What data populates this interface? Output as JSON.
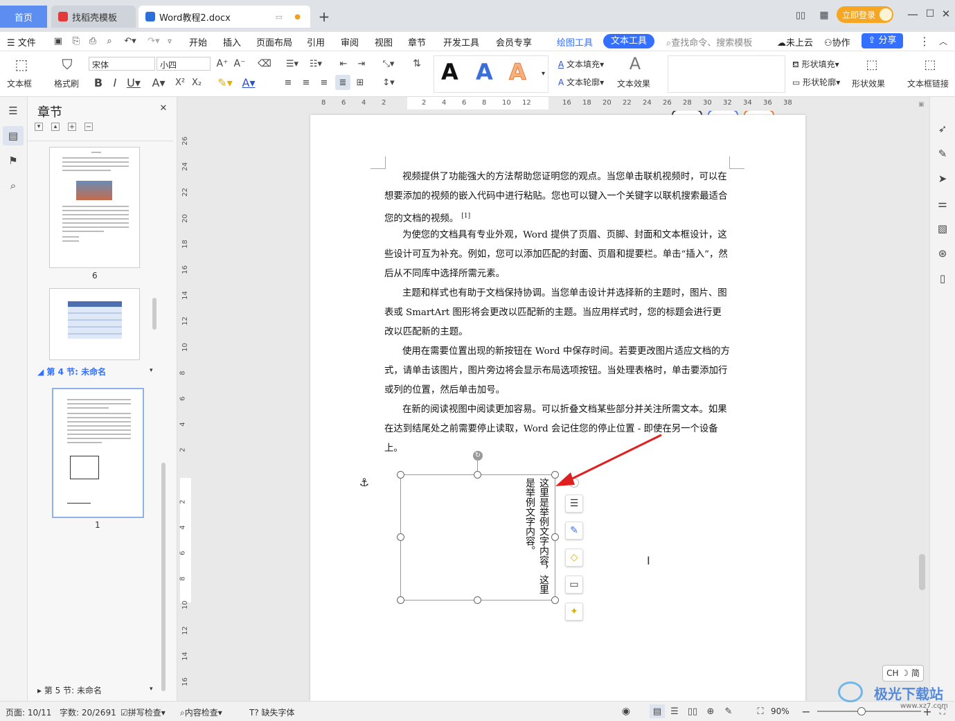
{
  "tabs": {
    "home": "首页",
    "templates": "找稻壳模板",
    "doc": "Word教程2.docx"
  },
  "window": {
    "login": "立即登录"
  },
  "menu": {
    "file": "文件",
    "items": [
      "开始",
      "插入",
      "页面布局",
      "引用",
      "审阅",
      "视图",
      "章节",
      "开发工具",
      "会员专享"
    ],
    "draw_tools": "绘图工具",
    "text_tools": "文本工具",
    "search": "查找命令、搜索模板",
    "cloud": "未上云",
    "collab": "协作",
    "share": "分享"
  },
  "toolbar": {
    "textbox": "文本框",
    "format_painter": "格式刷",
    "font": "宋体",
    "size": "小四",
    "text_fill": "文本填充",
    "text_outline": "文本轮廓",
    "text_effect": "文本效果",
    "style_a": "A",
    "abc": "Abc",
    "shape_fill": "形状填充",
    "shape_outline": "形状轮廓",
    "shape_effect": "形状效果",
    "textbox_link": "文本框链接"
  },
  "nav": {
    "title": "章节",
    "thumb6_num": "6",
    "section4": "第 4 节: 未命名",
    "thumb1_num": "1",
    "section5": "第 5 节: 未命名"
  },
  "hruler": [
    "8",
    "6",
    "4",
    "2",
    "",
    "2",
    "4",
    "6",
    "8",
    "10",
    "12",
    "",
    "16",
    "18",
    "20",
    "22",
    "24",
    "26",
    "28",
    "30",
    "32",
    "34",
    "36",
    "38"
  ],
  "vruler": [
    "26",
    "24",
    "22",
    "20",
    "18",
    "16",
    "14",
    "12",
    "10",
    "8",
    "6",
    "4",
    "2",
    "",
    "2",
    "4",
    "6",
    "8",
    "10",
    "12",
    "14",
    "16"
  ],
  "doc": {
    "p1": "视频提供了功能强大的方法帮助您证明您的观点。当您单击联机视频时，可以在想要添加的视频的嵌入代码中进行粘贴。您也可以键入一个关键字以联机搜索最适合您的文档的视频。",
    "p1_note": "[1]",
    "p2": "为使您的文档具有专业外观，Word 提供了页眉、页脚、封面和文本框设计，这些设计可互为补充。例如，您可以添加匹配的封面、页眉和提要栏。单击“插入”，然后从不同库中选择所需元素。",
    "p3": "主题和样式也有助于文档保持协调。当您单击设计并选择新的主题时，图片、图表或 SmartArt 图形将会更改以匹配新的主题。当应用样式时，您的标题会进行更改以匹配新的主题。",
    "p4": "使用在需要位置出现的新按钮在 Word 中保存时间。若要更改图片适应文档的方式，请单击该图片，图片旁边将会显示布局选项按钮。当处理表格时，单击要添加行或列的位置，然后单击加号。",
    "p5": "在新的阅读视图中阅读更加容易。可以折叠文档某些部分并关注所需文本。如果在达到结尾处之前需要停止读取，Word 会记住您的停止位置 - 即使在另一个设备上。",
    "textbox_col1": "这里是举例文字内容，这里",
    "textbox_col2": "是举例文字内容。"
  },
  "ime": "CH ☽ 简",
  "status": {
    "page": "页面: 10/11",
    "words": "字数: 20/2691",
    "spell": "拼写检查",
    "content": "内容检查",
    "font_missing": "缺失字体",
    "zoom": "90%"
  },
  "watermark": "极光下载站",
  "watermark_url": "www.xz7.com",
  "colors": {
    "accent": "#3370ff",
    "tab_active": "#5b8ef0",
    "login": "#f5a623",
    "arrow": "#e02020"
  }
}
